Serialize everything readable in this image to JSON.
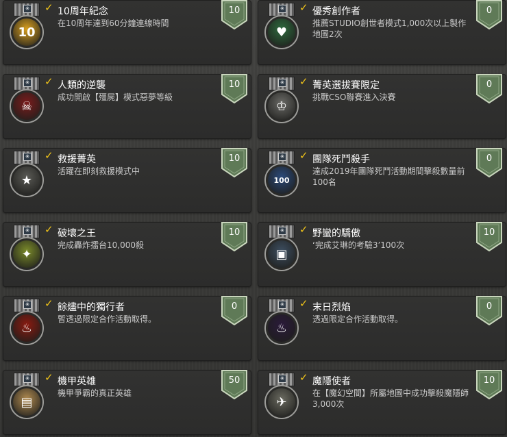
{
  "colors": {
    "card_bg": "#2f2f2e",
    "check": "#f0c419",
    "shield_fill": "#5f7a57",
    "shield_border": "#c9d6bd"
  },
  "achievements": [
    {
      "title": "10周年紀念",
      "desc": "在10周年達到60分鐘連線時間",
      "points": "10",
      "icon": "10th-anniversary-icon",
      "badge_color": "#d9a020",
      "glyph": "10"
    },
    {
      "title": "優秀創作者",
      "desc": "推薦STUDIO創世者模式1,000次以上製作地圖2次",
      "points": "0",
      "icon": "creator-card-icon",
      "badge_color": "#2e6b3e",
      "glyph": "♥"
    },
    {
      "title": "人類的逆襲",
      "desc": "成功開啟【殭屍】模式惡夢等級",
      "points": "10",
      "icon": "skull-icon",
      "badge_color": "#7a1c1c",
      "glyph": "☠"
    },
    {
      "title": "菁英選拔賽限定",
      "desc": "挑戰CSO聯賽進入決賽",
      "points": "0",
      "icon": "trophy-gear-icon",
      "badge_color": "#6a6a66",
      "glyph": "♔"
    },
    {
      "title": "救援菁英",
      "desc": "活躍在即刻救援模式中",
      "points": "10",
      "icon": "rescue-star-icon",
      "badge_color": "#5a5a55",
      "glyph": "★"
    },
    {
      "title": "團隊死鬥殺手",
      "desc": "達成2019年團隊死鬥活動期間擊殺數量前100名",
      "points": "0",
      "icon": "crossed-swords-icon",
      "badge_color": "#2b4a7a",
      "glyph": "100"
    },
    {
      "title": "破壞之王",
      "desc": "完成轟炸擂台10,000殺",
      "points": "10",
      "icon": "rocket-launcher-icon",
      "badge_color": "#7a8a2a",
      "glyph": "✦"
    },
    {
      "title": "野蠻的驕傲",
      "desc": "‘完成艾琳的考驗3’100次",
      "points": "10",
      "icon": "monitor-icon",
      "badge_color": "#3d4e60",
      "glyph": "▣"
    },
    {
      "title": " 餘燼中的獨行者",
      "desc": "暫透過限定合作活動取得。",
      "points": "0",
      "icon": "flame-chalice-icon",
      "badge_color": "#8a1a10",
      "glyph": "♨"
    },
    {
      "title": "末日烈焰",
      "desc": "透過限定合作活動取得。",
      "points": "0",
      "icon": "purple-flame-icon",
      "badge_color": "#2a1a3a",
      "glyph": "♨"
    },
    {
      "title": "機甲英雄",
      "desc": "機甲爭霸的真正英雄",
      "points": "50",
      "icon": "mech-hero-icon",
      "badge_color": "#b08a50",
      "glyph": "▤"
    },
    {
      "title": "魔隱使者",
      "desc": "在【魔幻空間】所屬地圖中成功擊殺魔隱師3,000次",
      "points": "10",
      "icon": "eagle-icon",
      "badge_color": "#6a6a60",
      "glyph": "✈"
    }
  ]
}
